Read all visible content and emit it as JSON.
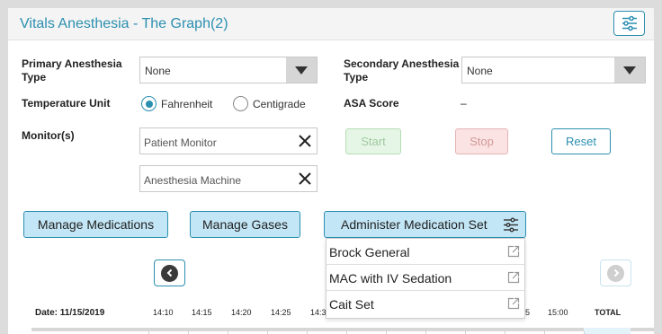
{
  "header": {
    "title": "Vitals Anesthesia - The Graph(2)",
    "settings_icon": "sliders-icon"
  },
  "form": {
    "primary_label_line1": "Primary Anesthesia",
    "primary_label_line2": "Type",
    "primary_value": "None",
    "secondary_label_line1": "Secondary Anesthesia",
    "secondary_label_line2": "Type",
    "secondary_value": "None",
    "temp_label": "Temperature Unit",
    "temp_options": [
      "Fahrenheit",
      "Centigrade"
    ],
    "temp_selected": "Fahrenheit",
    "asa_label": "ASA Score",
    "asa_value": "–",
    "monitors_label": "Monitor(s)",
    "monitors": [
      "Patient Monitor",
      "Anesthesia Machine"
    ]
  },
  "actions": {
    "start": "Start",
    "stop": "Stop",
    "reset": "Reset"
  },
  "toolbar": {
    "manage_medications": "Manage Medications",
    "manage_gases": "Manage Gases",
    "administer_set": "Administer Medication Set"
  },
  "medication_sets": [
    "Brock General",
    "MAC with IV Sedation",
    "Cait Set"
  ],
  "timeline": {
    "date": "Date: 11/15/2019",
    "times": [
      "14:10",
      "14:15",
      "14:20",
      "14:25",
      "14:3",
      "5",
      "15:00"
    ],
    "total": "TOTAL"
  },
  "colors": {
    "accent": "#2b8fb0",
    "button_fill": "#c3e6f6"
  }
}
